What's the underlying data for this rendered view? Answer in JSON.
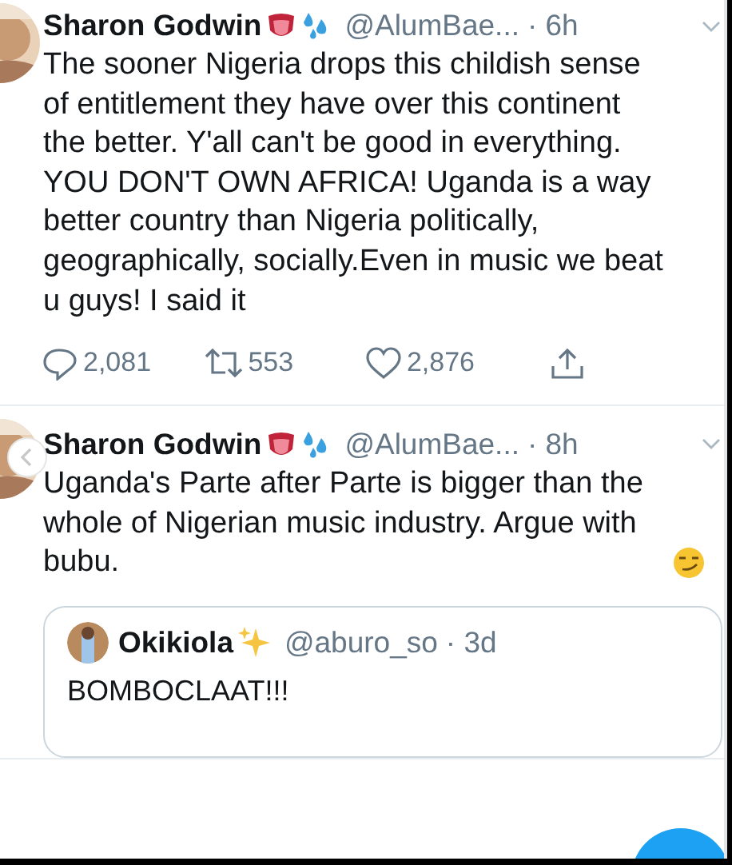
{
  "tweets": [
    {
      "name": "Sharon Godwin",
      "handle": "@AlumBae...",
      "time": "· 6h",
      "text": "The sooner Nigeria drops this childish sense of entitlement they have over this continent the better. Y'all can't be good in everything. YOU DON'T OWN AFRICA! Uganda is a way better country than Nigeria politically, geographically, socially.Even in music we beat u guys! I said it",
      "ends_with_smirk": false,
      "actions": [
        {
          "kind": "reply",
          "count": "2,081"
        },
        {
          "kind": "retweet",
          "count": "553"
        },
        {
          "kind": "like",
          "count": "2,876"
        },
        {
          "kind": "share"
        }
      ]
    },
    {
      "name": "Sharon Godwin",
      "handle": "@AlumBae...",
      "time": "· 8h",
      "text": "Uganda's Parte after Parte is bigger than the whole of Nigerian music industry. Argue with bubu.",
      "ends_with_smirk": true,
      "quote": {
        "name": "Okikiola",
        "handle": "@aburo_so",
        "time": "· 3d",
        "text": "BOMBOCLAAT!!!"
      }
    }
  ]
}
